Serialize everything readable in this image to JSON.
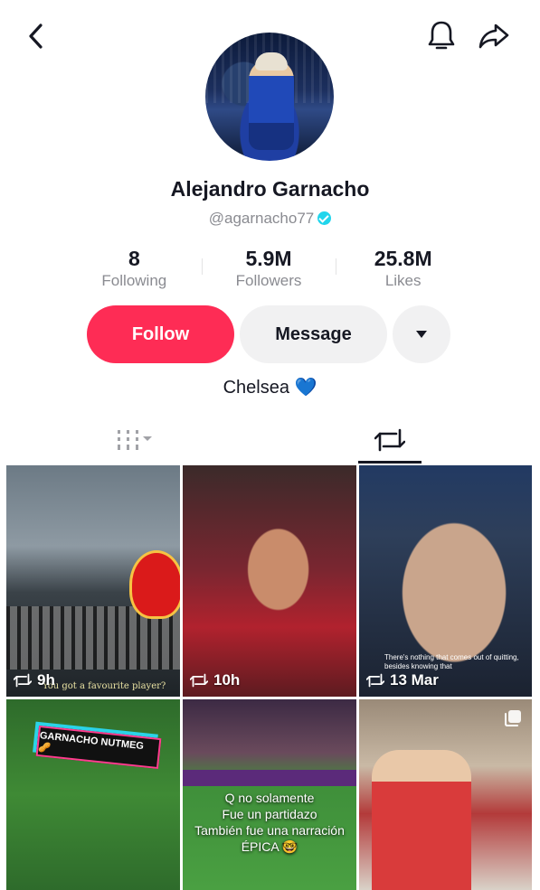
{
  "header": {
    "back_icon": "chevron-left-icon",
    "bell_icon": "bell-icon",
    "share_icon": "share-arrow-icon"
  },
  "profile": {
    "name": "Alejandro Garnacho",
    "handle": "@agarnacho77",
    "verified": true,
    "bio": "Chelsea 💙"
  },
  "stats": [
    {
      "value": "8",
      "label": "Following"
    },
    {
      "value": "5.9M",
      "label": "Followers"
    },
    {
      "value": "25.8M",
      "label": "Likes"
    }
  ],
  "actions": {
    "follow_label": "Follow",
    "message_label": "Message",
    "more_icon": "caret-down-icon"
  },
  "tabs": {
    "grid_icon": "videos-grid-icon",
    "repost_icon": "repost-icon",
    "active": "repost"
  },
  "videos": [
    {
      "time": "9h",
      "caption": "You got a favourite player?"
    },
    {
      "time": "10h",
      "caption": ""
    },
    {
      "time": "13 Mar",
      "caption": "There's nothing that comes out of quitting, besides knowing that"
    },
    {
      "time": "",
      "caption": "GARNACHO NUTMEG 🥜"
    },
    {
      "time": "",
      "caption": "Q no solamente\nFue un partidazo\nTambién fue una narración\nÉPICA 🤓"
    },
    {
      "time": "",
      "caption": ""
    }
  ],
  "colors": {
    "accent": "#fe2c55",
    "verified": "#20d5ec",
    "secondary_button": "#f1f1f2"
  }
}
